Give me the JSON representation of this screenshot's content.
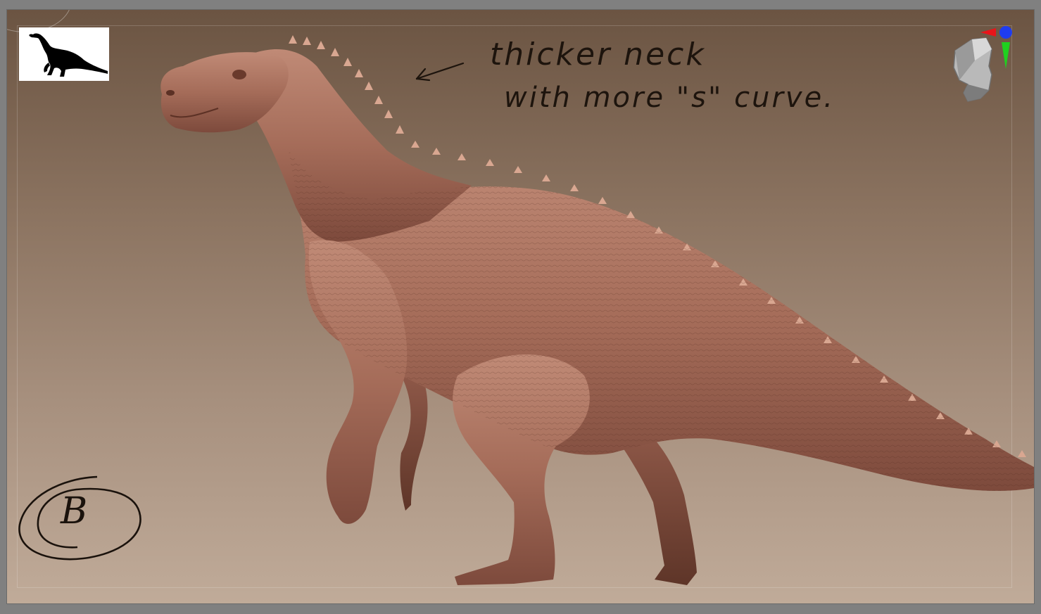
{
  "viewport": {
    "background_top": "#6b5442",
    "background_bottom": "#c0ab99"
  },
  "thumbnail": {
    "icon": "dinosaur-silhouette-icon"
  },
  "annotation": {
    "line1": "thicker neck",
    "line2": "with more \"s\" curve.",
    "arrow": "arrow-pointing-left-icon"
  },
  "model": {
    "skin_color": "#a9725f",
    "icon": "iguanodon-sculpt"
  },
  "navigation_gizmo": {
    "icon": "view-orientation-head-icon",
    "x_axis_color": "#e8141a",
    "y_axis_color": "#1fd11f",
    "z_axis_color": "#1f3cf0"
  },
  "version_mark": {
    "letter": "B"
  }
}
